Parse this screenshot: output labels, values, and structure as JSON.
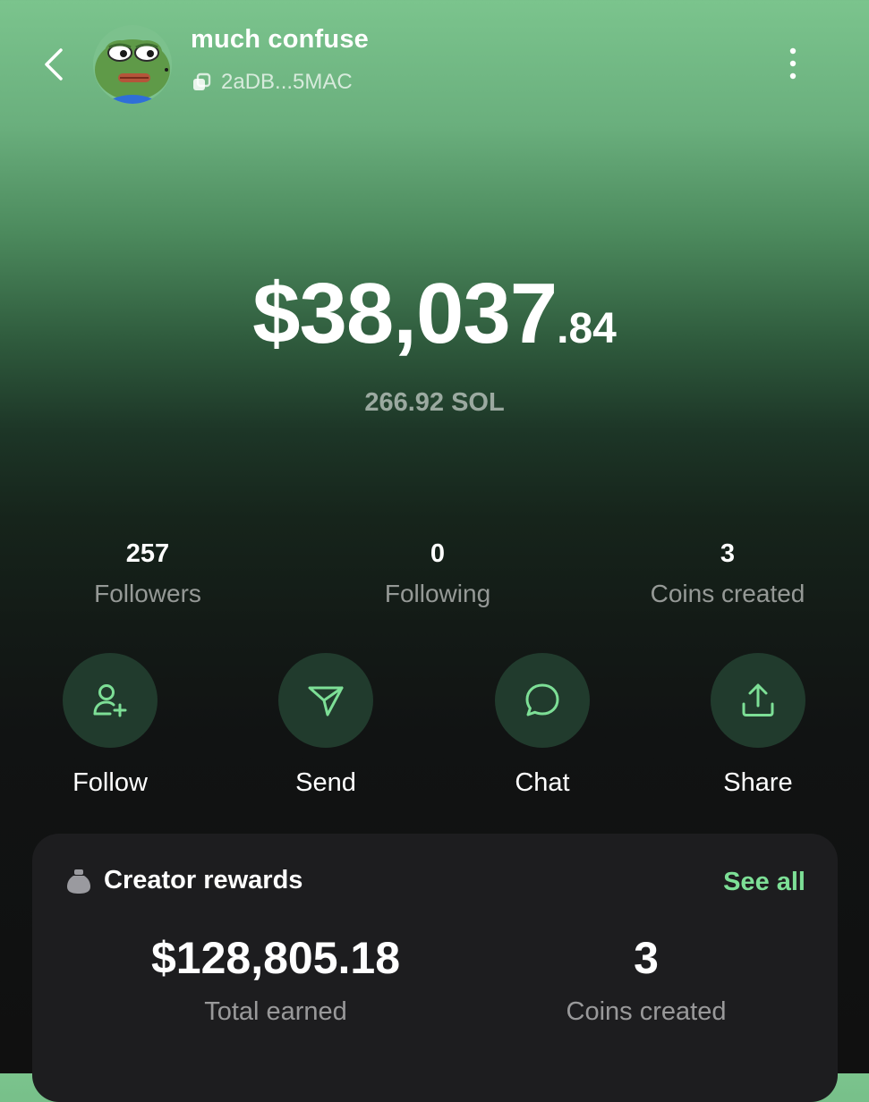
{
  "header": {
    "user_name": "much confuse",
    "wallet_address": "2aDB...5MAC",
    "icons": {
      "back": "chevron-left-icon",
      "copy": "copy-icon",
      "more": "more-vertical-icon"
    }
  },
  "balance": {
    "usd_main": "$38,037",
    "usd_cents": ".84",
    "sol": "266.92 SOL"
  },
  "stats": [
    {
      "value": "257",
      "label": "Followers"
    },
    {
      "value": "0",
      "label": "Following"
    },
    {
      "value": "3",
      "label": "Coins created"
    }
  ],
  "actions": [
    {
      "label": "Follow",
      "icon": "add-user-icon"
    },
    {
      "label": "Send",
      "icon": "send-icon"
    },
    {
      "label": "Chat",
      "icon": "chat-bubble-icon"
    },
    {
      "label": "Share",
      "icon": "share-icon"
    }
  ],
  "rewards": {
    "title": "Creator rewards",
    "see_all": "See all",
    "total_earned_value": "$128,805.18",
    "total_earned_label": "Total earned",
    "coins_created_value": "3",
    "coins_created_label": "Coins created"
  },
  "colors": {
    "accent": "#7ddf96",
    "action_circle": "#213b2d",
    "card_bg": "#1d1d1f",
    "gradient_top": "#7bc48d",
    "background_bottom": "#101010"
  }
}
